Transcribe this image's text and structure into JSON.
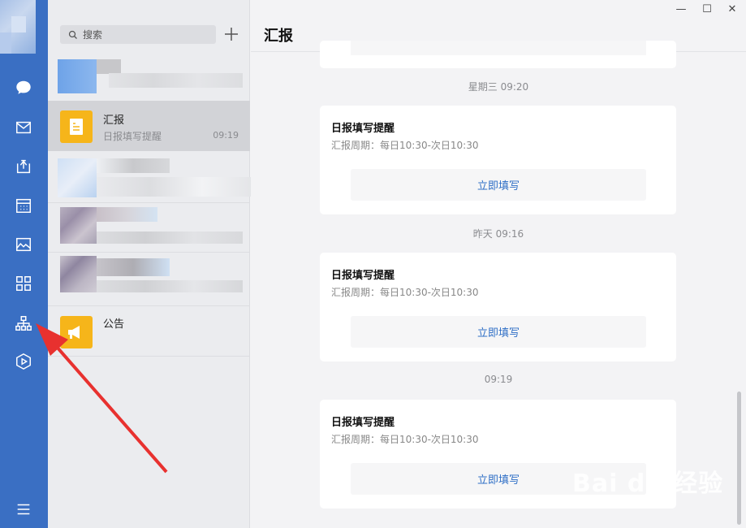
{
  "window": {
    "minimize": "—",
    "maximize": "☐",
    "close": "✕"
  },
  "search": {
    "placeholder": "搜索"
  },
  "conversations": [
    {
      "name": "汇报",
      "preview": "日报填写提醒",
      "time": "09:19"
    },
    {
      "name": "公告"
    }
  ],
  "main": {
    "title": "汇报",
    "messages": [
      {
        "timestamp": "星期三 09:20",
        "title": "日报填写提醒",
        "period": "汇报周期：每日10:30-次日10:30",
        "action": "立即填写"
      },
      {
        "timestamp": "昨天 09:16",
        "title": "日报填写提醒",
        "period": "汇报周期：每日10:30-次日10:30",
        "action": "立即填写"
      },
      {
        "timestamp": "09:19",
        "title": "日报填写提醒",
        "period": "汇报周期：每日10:30-次日10:30",
        "action": "立即填写"
      }
    ]
  },
  "watermark": {
    "logo": "Bai du 经验",
    "url": "jingyan.baidu.com"
  },
  "colors": {
    "rail": "#3a6fc3",
    "accent": "#2f6fc6",
    "icon_yellow": "#f6b51a",
    "arrow": "#e8312f"
  },
  "rail_icons": [
    "chat-icon",
    "mail-icon",
    "share-box-icon",
    "calendar-icon",
    "image-icon",
    "apps-grid-icon",
    "org-chart-icon",
    "hexagon-play-icon",
    "menu-icon"
  ]
}
